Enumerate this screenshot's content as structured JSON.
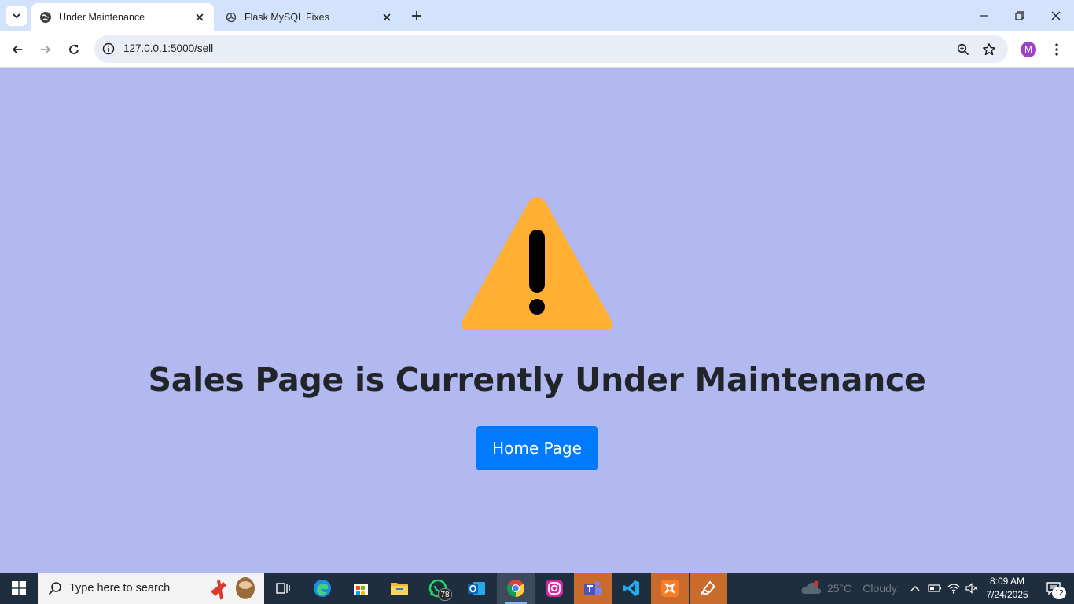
{
  "browser": {
    "tabs": [
      {
        "title": "Under Maintenance",
        "active": true
      },
      {
        "title": "Flask MySQL Fixes",
        "active": false
      }
    ],
    "url": "127.0.0.1:5000/sell",
    "profile_initial": "M",
    "icons": {
      "tab_search": "chevron-down-icon",
      "back": "back-arrow-icon",
      "forward": "forward-arrow-icon",
      "reload": "reload-icon",
      "site_info": "info-icon",
      "zoom": "zoom-icon",
      "bookmark": "star-icon",
      "menu": "menu-dots-icon"
    }
  },
  "page": {
    "background": "#b2b8f0",
    "heading": "Sales Page is Currently Under Maintenance",
    "button_label": "Home Page",
    "button_color": "#007bff",
    "warning_color": "#ffaf31"
  },
  "taskbar": {
    "search_placeholder": "Type here to search",
    "apps": [
      "task-view-icon",
      "edge-icon",
      "store-icon",
      "file-explorer-icon",
      "whatsapp-icon",
      "outlook-icon",
      "chrome-icon",
      "instagram-icon",
      "teams-icon",
      "vscode-icon",
      "xampp-icon",
      "sketch-app-icon"
    ],
    "whatsapp_badge": "78",
    "weather": {
      "temp": "25°C",
      "condition": "Cloudy"
    },
    "clock": {
      "time": "8:09 AM",
      "date": "7/24/2025"
    },
    "notification_count": "12"
  }
}
